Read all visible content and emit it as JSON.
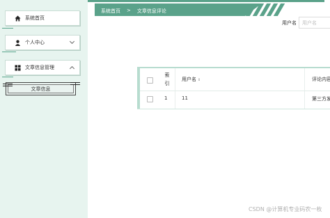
{
  "sidebar": {
    "items": [
      {
        "label": "系统首页",
        "icon": "home-icon"
      },
      {
        "label": "个人中心",
        "icon": "user-icon"
      },
      {
        "label": "文章信息管理",
        "icon": "grid-icon"
      }
    ],
    "submenu": {
      "label": "文章信息"
    }
  },
  "header": {
    "breadcrumb": {
      "home": "系统首页",
      "separator": ">",
      "current": "文章信息评论"
    }
  },
  "search": {
    "label": "用户名",
    "placeholder": "用户名"
  },
  "table": {
    "columns": [
      "索引",
      "用户名",
      "评论内容"
    ],
    "index_header_line1": "索",
    "index_header_line2": "引",
    "sort_glyph": "⇕",
    "rows": [
      {
        "index": "1",
        "username": "11",
        "comment": "第三方发"
      }
    ]
  },
  "watermark": "CSDN @计算机专业码农一枚",
  "colors": {
    "accent": "#5aa28a",
    "sidebar_bg": "#e7f4ef",
    "table_border": "#b7dccf"
  }
}
